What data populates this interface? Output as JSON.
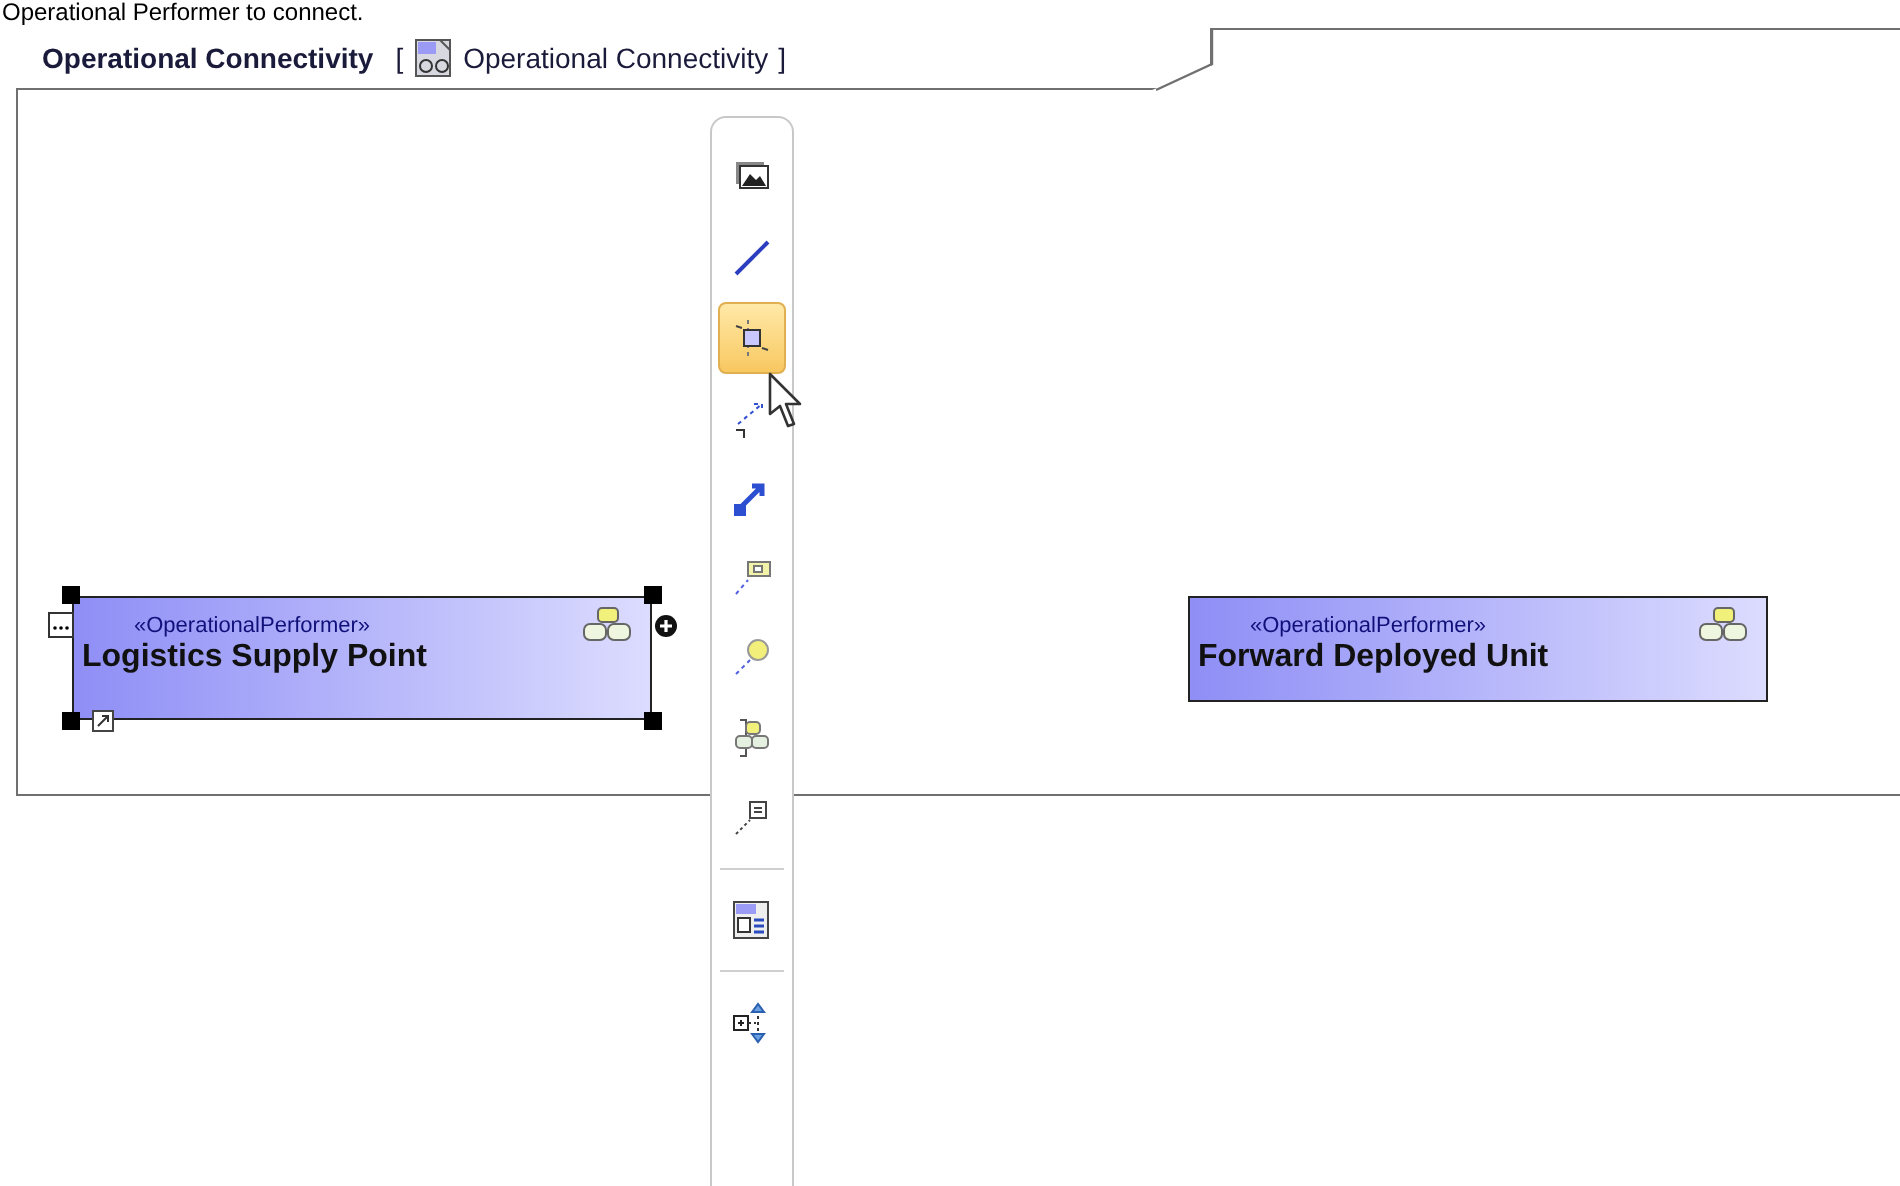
{
  "caption": "Operational Performer to connect.",
  "frame": {
    "title": "Operational Connectivity",
    "open_bracket": "[",
    "diagram_name": "Operational Connectivity",
    "close_bracket": "]"
  },
  "nodes": [
    {
      "stereotype": "«OperationalPerformer»",
      "name": "Logistics Supply Point",
      "selected": true
    },
    {
      "stereotype": "«OperationalPerformer»",
      "name": "Forward Deployed Unit",
      "selected": false
    }
  ],
  "toolbar": {
    "groups": [
      [
        {
          "selected": false
        },
        {
          "selected": false
        },
        {
          "selected": true
        },
        {
          "selected": false
        },
        {
          "selected": false
        },
        {
          "selected": false
        },
        {
          "selected": false
        },
        {
          "selected": false
        },
        {
          "selected": false
        }
      ],
      [
        {
          "selected": false
        }
      ],
      [
        {
          "selected": false
        }
      ]
    ]
  }
}
